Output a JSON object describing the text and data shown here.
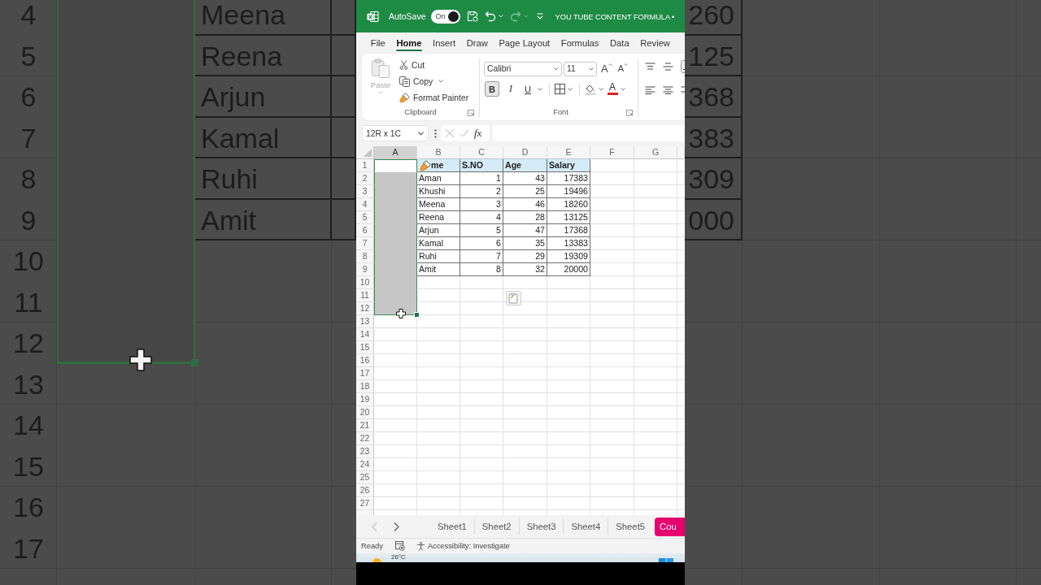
{
  "backdrop": {
    "rows": [
      {
        "label": "4",
        "selected": true,
        "name": "Meena",
        "salary_tail": "260"
      },
      {
        "label": "5",
        "selected": true,
        "name": "Reena",
        "salary_tail": "125"
      },
      {
        "label": "6",
        "selected": true,
        "name": "Arjun",
        "salary_tail": "368"
      },
      {
        "label": "7",
        "selected": true,
        "name": "Kamal",
        "salary_tail": "383"
      },
      {
        "label": "8",
        "selected": true,
        "name": "Ruhi",
        "salary_tail": "309"
      },
      {
        "label": "9",
        "selected": true,
        "name": "Amit",
        "salary_tail": "000"
      },
      {
        "label": "10",
        "selected": true
      },
      {
        "label": "11",
        "selected": true
      },
      {
        "label": "12",
        "selected": true
      },
      {
        "label": "13",
        "selected": false
      },
      {
        "label": "14",
        "selected": false
      },
      {
        "label": "15",
        "selected": false
      },
      {
        "label": "16",
        "selected": false
      },
      {
        "label": "17",
        "selected": false
      }
    ]
  },
  "title_bar": {
    "autosave_label": "AutoSave",
    "autosave": {
      "label": "On",
      "on": true
    },
    "quick_access": [
      {
        "kind": "save",
        "disabled": false
      },
      {
        "kind": "undo",
        "disabled": false
      },
      {
        "kind": "redo",
        "disabled": true
      },
      {
        "kind": "customize",
        "disabled": false
      }
    ],
    "title": "YOU TUBE CONTENT FORMULA •"
  },
  "menu_tabs": [
    {
      "label": "File",
      "selected": false
    },
    {
      "label": "Home",
      "selected": true
    },
    {
      "label": "Insert",
      "selected": false
    },
    {
      "label": "Draw",
      "selected": false
    },
    {
      "label": "Page Layout",
      "selected": false
    },
    {
      "label": "Formulas",
      "selected": false
    },
    {
      "label": "Data",
      "selected": false
    },
    {
      "label": "Review",
      "selected": false
    }
  ],
  "ribbon": {
    "clipboard": {
      "paste": {
        "label": "Paste",
        "disabled": true
      },
      "commands": [
        {
          "kind": "cut",
          "label": "Cut"
        },
        {
          "kind": "copy",
          "label": "Copy"
        },
        {
          "kind": "format-painter",
          "label": "Format Painter"
        }
      ],
      "group_label": "Clipboard"
    },
    "font": {
      "font_name": "Calibri",
      "font_size": "11",
      "size_buttons": [
        {
          "kind": "grow",
          "label": "A"
        },
        {
          "kind": "shrink",
          "label": "A"
        }
      ],
      "style_buttons": [
        {
          "kind": "bold",
          "label": "B",
          "on": true
        },
        {
          "kind": "italic",
          "label": "I",
          "on": false
        },
        {
          "kind": "underline",
          "label": "U",
          "on": false
        }
      ],
      "color_label": "A",
      "group_label": "Font"
    }
  },
  "formula_bar": {
    "name_box": "12R x 1C",
    "function_label": "fx"
  },
  "grid": {
    "columns": [
      {
        "label": "A",
        "selected": true
      },
      {
        "label": "B",
        "selected": false
      },
      {
        "label": "C",
        "selected": false
      },
      {
        "label": "D",
        "selected": false
      },
      {
        "label": "E",
        "selected": false
      },
      {
        "label": "F",
        "selected": false
      },
      {
        "label": "G",
        "selected": false
      }
    ],
    "rows": [
      {
        "label": "1",
        "kind": "header",
        "selected": true,
        "active": true,
        "cells": [
          "me",
          "S.NO",
          "Age",
          "Salary"
        ]
      },
      {
        "label": "2",
        "kind": "data",
        "selected": true,
        "active": false,
        "cells": [
          "Aman",
          "1",
          "43",
          "17383"
        ]
      },
      {
        "label": "3",
        "kind": "data",
        "selected": true,
        "active": false,
        "cells": [
          "Khushi",
          "2",
          "25",
          "19496"
        ]
      },
      {
        "label": "4",
        "kind": "data",
        "selected": true,
        "active": false,
        "cells": [
          "Meena",
          "3",
          "46",
          "18260"
        ]
      },
      {
        "label": "5",
        "kind": "data",
        "selected": true,
        "active": false,
        "cells": [
          "Reena",
          "4",
          "28",
          "13125"
        ]
      },
      {
        "label": "6",
        "kind": "data",
        "selected": true,
        "active": false,
        "cells": [
          "Arjun",
          "5",
          "47",
          "17368"
        ]
      },
      {
        "label": "7",
        "kind": "data",
        "selected": true,
        "active": false,
        "cells": [
          "Kamal",
          "6",
          "35",
          "13383"
        ]
      },
      {
        "label": "8",
        "kind": "data",
        "selected": true,
        "active": false,
        "cells": [
          "Ruhi",
          "7",
          "29",
          "19309"
        ]
      },
      {
        "label": "9",
        "kind": "data",
        "selected": true,
        "active": false,
        "cells": [
          "Amit",
          "8",
          "32",
          "20000"
        ]
      },
      {
        "label": "10",
        "kind": "empty",
        "selected": true,
        "active": false
      },
      {
        "label": "11",
        "kind": "empty",
        "selected": true,
        "active": false
      },
      {
        "label": "12",
        "kind": "empty",
        "selected": true,
        "active": false
      },
      {
        "label": "13",
        "kind": "empty",
        "selected": false,
        "active": false
      },
      {
        "label": "14",
        "kind": "empty",
        "selected": false,
        "active": false
      },
      {
        "label": "15",
        "kind": "empty",
        "selected": false,
        "active": false
      },
      {
        "label": "16",
        "kind": "empty",
        "selected": false,
        "active": false
      },
      {
        "label": "17",
        "kind": "empty",
        "selected": false,
        "active": false
      },
      {
        "label": "18",
        "kind": "empty",
        "selected": false,
        "active": false
      },
      {
        "label": "19",
        "kind": "empty",
        "selected": false,
        "active": false
      },
      {
        "label": "20",
        "kind": "empty",
        "selected": false,
        "active": false
      },
      {
        "label": "21",
        "kind": "empty",
        "selected": false,
        "active": false
      },
      {
        "label": "22",
        "kind": "empty",
        "selected": false,
        "active": false
      },
      {
        "label": "23",
        "kind": "empty",
        "selected": false,
        "active": false
      },
      {
        "label": "24",
        "kind": "empty",
        "selected": false,
        "active": false
      },
      {
        "label": "25",
        "kind": "empty",
        "selected": false,
        "active": false
      },
      {
        "label": "26",
        "kind": "empty",
        "selected": false,
        "active": false
      },
      {
        "label": "27",
        "kind": "empty",
        "selected": false,
        "active": false
      }
    ]
  },
  "sheet_nav": [
    {
      "kind": "previous",
      "disabled": true
    },
    {
      "kind": "next",
      "disabled": false
    }
  ],
  "sheet_tabs": [
    {
      "label": "Sheet1",
      "selected": false
    },
    {
      "label": "Sheet2",
      "selected": false
    },
    {
      "label": "Sheet3",
      "selected": false
    },
    {
      "label": "Sheet4",
      "selected": false
    },
    {
      "label": "Sheet5",
      "selected": false
    },
    {
      "label": "Cou",
      "selected": false,
      "color": "#e5006e"
    }
  ],
  "status_bar": {
    "status": "Ready",
    "accessibility": "Accessibility: Investigate"
  },
  "taskbar": {
    "temperature": "26°C"
  }
}
